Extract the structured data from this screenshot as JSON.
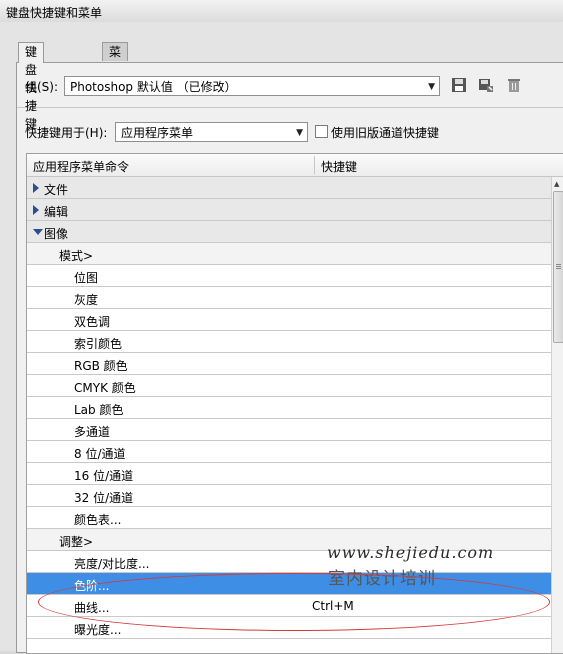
{
  "window": {
    "title": "键盘快捷键和菜单"
  },
  "tabs": [
    {
      "label": "键盘快捷键"
    },
    {
      "label": "菜单"
    }
  ],
  "set_row": {
    "label": "组(S):",
    "value": "Photoshop 默认值 （已修改）",
    "icons": [
      "save-icon",
      "save-as-icon",
      "delete-icon"
    ]
  },
  "shortcuts_for": {
    "label": "快捷键用于(H):",
    "value": "应用程序菜单",
    "legacy_checkbox_label": "使用旧版通道快捷键",
    "legacy_checked": false
  },
  "list": {
    "col1": "应用程序菜单命令",
    "col2": "快捷键",
    "rows": [
      {
        "text": "文件",
        "shortcut": "",
        "type": "group",
        "expanded": false
      },
      {
        "text": "编辑",
        "shortcut": "",
        "type": "group",
        "expanded": false
      },
      {
        "text": "图像",
        "shortcut": "",
        "type": "group",
        "expanded": true
      },
      {
        "text": "模式>",
        "shortcut": "",
        "type": "sub"
      },
      {
        "text": "位图",
        "shortcut": "",
        "type": "item"
      },
      {
        "text": "灰度",
        "shortcut": "",
        "type": "item"
      },
      {
        "text": "双色调",
        "shortcut": "",
        "type": "item"
      },
      {
        "text": "索引颜色",
        "shortcut": "",
        "type": "item"
      },
      {
        "text": "RGB 颜色",
        "shortcut": "",
        "type": "item"
      },
      {
        "text": "CMYK 颜色",
        "shortcut": "",
        "type": "item"
      },
      {
        "text": "Lab 颜色",
        "shortcut": "",
        "type": "item"
      },
      {
        "text": "多通道",
        "shortcut": "",
        "type": "item"
      },
      {
        "text": "8 位/通道",
        "shortcut": "",
        "type": "item"
      },
      {
        "text": "16 位/通道",
        "shortcut": "",
        "type": "item"
      },
      {
        "text": "32 位/通道",
        "shortcut": "",
        "type": "item"
      },
      {
        "text": "颜色表...",
        "shortcut": "",
        "type": "item"
      },
      {
        "text": "调整>",
        "shortcut": "",
        "type": "sub"
      },
      {
        "text": "亮度/对比度...",
        "shortcut": "",
        "type": "item"
      },
      {
        "text": "色阶...",
        "shortcut": "",
        "type": "item",
        "selected": true
      },
      {
        "text": "曲线...",
        "shortcut": "Ctrl+M",
        "type": "item"
      },
      {
        "text": "曝光度...",
        "shortcut": "",
        "type": "item"
      }
    ]
  },
  "watermark": {
    "url": "www.shejiedu.com",
    "text": "室内设计培训"
  },
  "colors": {
    "selection": "#3f8ee6",
    "annotation": "#d43a3a"
  }
}
